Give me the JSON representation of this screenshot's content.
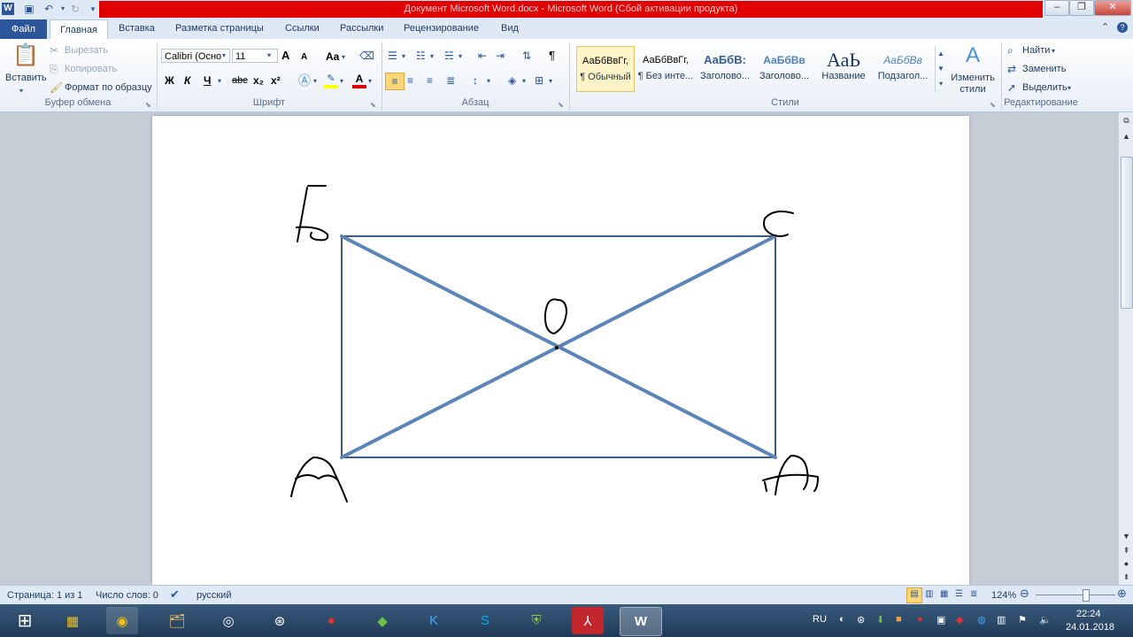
{
  "window": {
    "title": "Документ Microsoft Word.docx  -  Microsoft Word (Сбой активации продукта)",
    "app_icon": "W",
    "controls": [
      "‒",
      "❐",
      "✕"
    ]
  },
  "tabs": {
    "file": "Файл",
    "items": [
      "Главная",
      "Вставка",
      "Разметка страницы",
      "Ссылки",
      "Рассылки",
      "Рецензирование",
      "Вид"
    ],
    "help": "?"
  },
  "ribbon": {
    "clipboard": {
      "paste": "Вставить",
      "cut": "Вырезать",
      "copy": "Копировать",
      "format_painter": "Формат по образцу",
      "label": "Буфер обмена"
    },
    "font": {
      "name": "Calibri (Осно",
      "size": "11",
      "grow": "A",
      "shrink": "A",
      "case": "Aa",
      "bold": "Ж",
      "italic": "К",
      "underline": "Ч",
      "strike": "abc",
      "sub": "x₂",
      "sup": "x²",
      "label": "Шрифт"
    },
    "paragraph": {
      "label": "Абзац",
      "pilcrow": "¶"
    },
    "styles": {
      "items": [
        {
          "sample": "АаБбВвГг,",
          "name": "¶ Обычный"
        },
        {
          "sample": "АаБбВвГг,",
          "name": "¶ Без инте..."
        },
        {
          "sample": "АаБбВ:",
          "name": "Заголово..."
        },
        {
          "sample": "АаБбВв",
          "name": "Заголово..."
        },
        {
          "sample": "АаЬ",
          "name": "Название"
        },
        {
          "sample": "АаБбВв",
          "name": "Подзагол..."
        }
      ],
      "change": "Изменить стили",
      "label": "Стили"
    },
    "editing": {
      "find": "Найти",
      "replace": "Заменить",
      "select": "Выделить",
      "label": "Редактирование"
    }
  },
  "status": {
    "page": "Страница: 1 из 1",
    "words": "Число слов: 0",
    "language": "русский",
    "zoom": "124%",
    "zoom_fraction": 0.62
  },
  "taskbar": {
    "lang": "RU",
    "time": "22:24",
    "date": "24.01.2018"
  },
  "colors": {
    "rect_stroke": "#3d5a7a",
    "diag_stroke": "#5b84b8",
    "title_red": "#e00000",
    "file_tab": "#2b579a"
  }
}
